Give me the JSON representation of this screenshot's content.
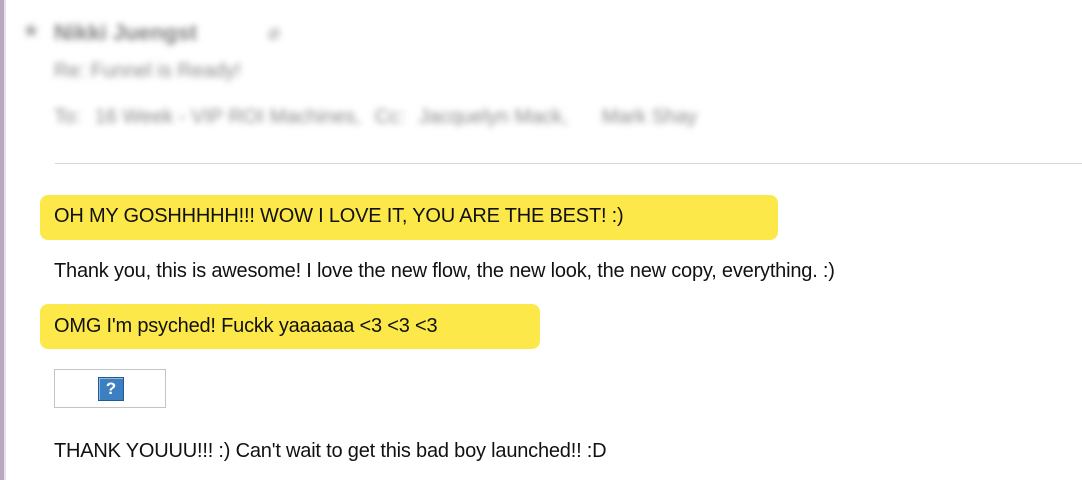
{
  "email": {
    "header": {
      "star_icon": "star-icon",
      "sender": "Nikki Juengst",
      "attachment_icon": "paperclip-icon",
      "subject": "Re: Funnel is Ready!",
      "to_label": "To:",
      "to_value": "16 Week - VIP ROI Machines,",
      "cc_label": "Cc:",
      "cc_values": [
        "Jacquelyn Mack,",
        "Mark Shay"
      ]
    },
    "body": {
      "line1": "OH MY GOSHHHHH!!! WOW I LOVE IT, YOU ARE THE BEST! :)",
      "line2": "Thank you, this is awesome! I love the new flow, the new look, the new copy, everything. :)",
      "line3": "OMG I'm psyched! Fuckk yaaaaaa <3 <3 <3",
      "broken_image_glyph": "?",
      "line4": "THANK YOUUU!!! :) Can't wait to get this bad boy launched!! :D"
    },
    "colors": {
      "highlight": "#fde84a",
      "left_edge": "#b7a9bf",
      "broken_image_icon": "#3d7fc1"
    }
  }
}
